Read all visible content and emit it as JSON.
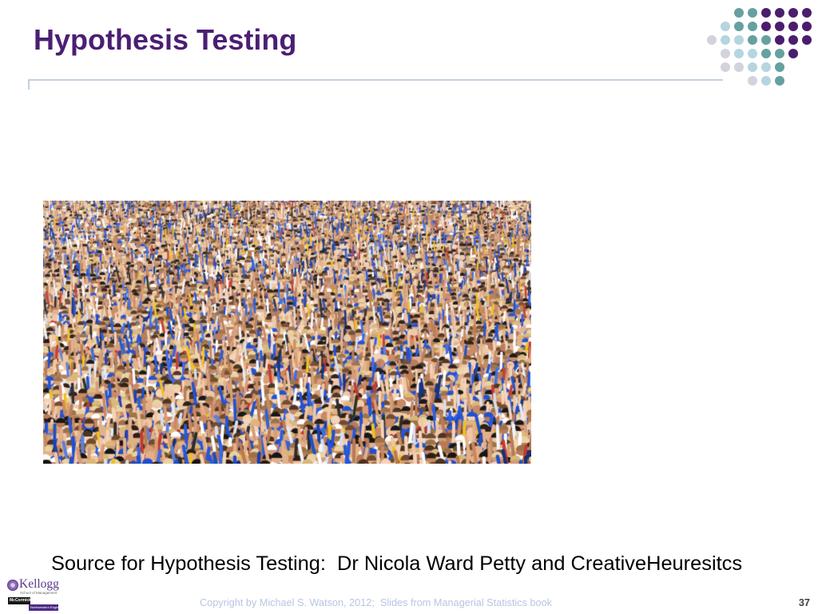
{
  "slide": {
    "title": "Hypothesis Testing",
    "source_note": "Source for Hypothesis Testing:  Dr Nicola Ward Petty and CreativeHeuresitcs",
    "footer": {
      "copyright": "Copyright by Michael S. Watson, 2012;  Slides from Managerial Statistics book",
      "slide_number": "37"
    },
    "logos": {
      "kellogg": "Kellogg",
      "kellogg_sub": "School of Management",
      "mccormick": "McCormick",
      "mccormick_sub": "Northwestern Engineering"
    }
  },
  "theme": {
    "title_color": "#4b1f73",
    "dot_purple": "#4a1d6e",
    "dot_teal": "#66a0a0",
    "dot_light_blue": "#b5d5df",
    "dot_gray": "#d3d3dd",
    "rule_color": "#c4d0dd",
    "footer_text_color": "#b7c6e2",
    "slide_number_color": "#3f3f3f",
    "body_text_color": "#000000",
    "kellogg_purple": "#5a3a8c",
    "northwestern_purple": "#4e2a84"
  }
}
